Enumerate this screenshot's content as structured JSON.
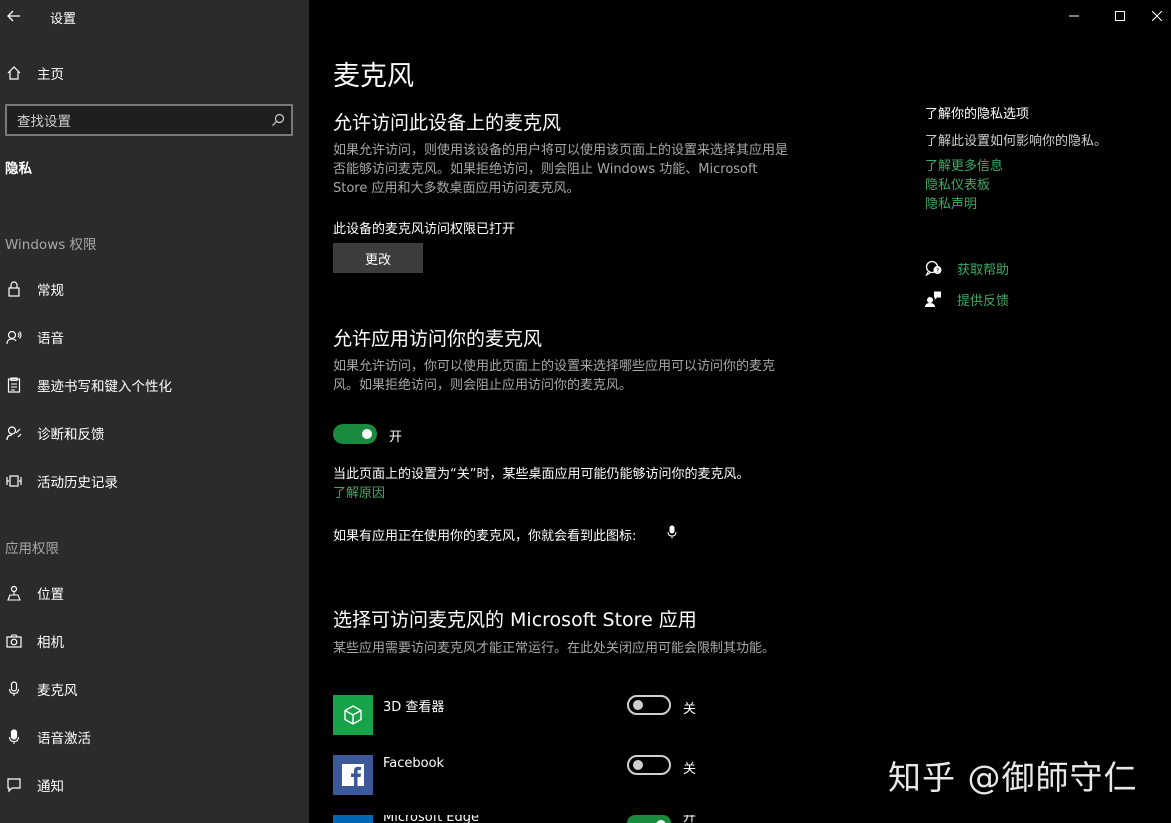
{
  "window": {
    "title": "设置",
    "back_icon": "back-arrow-icon",
    "controls": [
      "minimize-icon",
      "maximize-icon",
      "close-icon"
    ]
  },
  "sidebar": {
    "home_label": "主页",
    "search_placeholder": "查找设置",
    "group_label": "隐私",
    "windows_section": "Windows 权限",
    "windows_items": [
      {
        "label": "常规",
        "icon": "lock-icon"
      },
      {
        "label": "语音",
        "icon": "speech-icon"
      },
      {
        "label": "墨迹书写和键入个性化",
        "icon": "clipboard-icon"
      },
      {
        "label": "诊断和反馈",
        "icon": "diagnostics-icon"
      },
      {
        "label": "活动历史记录",
        "icon": "activity-history-icon"
      }
    ],
    "app_section": "应用权限",
    "app_items": [
      {
        "label": "位置",
        "icon": "location-icon"
      },
      {
        "label": "相机",
        "icon": "camera-icon"
      },
      {
        "label": "麦克风",
        "icon": "microphone-icon"
      },
      {
        "label": "语音激活",
        "icon": "voice-activation-icon"
      },
      {
        "label": "通知",
        "icon": "notification-icon"
      }
    ]
  },
  "main": {
    "title": "麦克风",
    "device": {
      "heading": "允许访问此设备上的麦克风",
      "description": "如果允许访问，则使用该设备的用户将可以使用该页面上的设置来选择其应用是否能够访问麦克风。如果拒绝访问，则会阻止 Windows 功能、Microsoft Store 应用和大多数桌面应用访问麦克风。",
      "status": "此设备的麦克风访问权限已打开",
      "change_button": "更改"
    },
    "apps_access": {
      "heading": "允许应用访问你的麦克风",
      "description": "如果允许访问，你可以使用此页面上的设置来选择哪些应用可以访问你的麦克风。如果拒绝访问，则会阻止应用访问你的麦克风。",
      "toggle_label": "开",
      "toggle_on": true,
      "note": "当此页面上的设置为“关”时，某些桌面应用可能仍能够访问你的麦克风。",
      "note_link": "了解原因",
      "indicator_text": "如果有应用正在使用你的麦克风，你就会看到此图标:"
    },
    "store_apps": {
      "heading": "选择可访问麦克风的 Microsoft Store 应用",
      "description": "某些应用需要访问麦克风才能正常运行。在此处关闭应用可能会限制其功能。",
      "apps": [
        {
          "name": "3D 查看器",
          "toggle_label": "关",
          "on": false,
          "color": "#16a34a",
          "icon": "3d-cube-icon"
        },
        {
          "name": "Facebook",
          "toggle_label": "关",
          "on": false,
          "color": "#3b5998",
          "icon": "facebook-icon"
        },
        {
          "name": "Microsoft Edge",
          "toggle_label": "开",
          "on": true,
          "color": "#0067b8",
          "icon": "edge-icon"
        }
      ]
    }
  },
  "right": {
    "title": "了解你的隐私选项",
    "text": "了解此设置如何影响你的隐私。",
    "links": [
      "了解更多信息",
      "隐私仪表板",
      "隐私声明"
    ],
    "help_label": "获取帮助",
    "feedback_label": "提供反馈"
  },
  "watermark": "知乎 @御師守仁",
  "colors": {
    "accent": "#3eaa62",
    "toggle_on": "#1a8a3f",
    "sidebar_bg": "#2b2b2b"
  }
}
